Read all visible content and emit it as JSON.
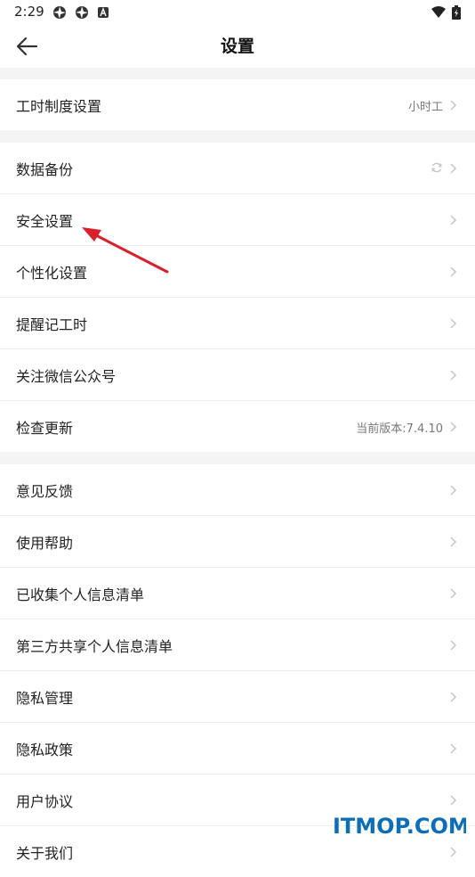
{
  "status_bar": {
    "time": "2:29",
    "left_icons": [
      "aperture-icon",
      "aperture-icon",
      "font-icon"
    ],
    "right_icons": [
      "wifi-icon",
      "battery-icon"
    ]
  },
  "header": {
    "title": "设置",
    "back_icon": "arrow-left-icon"
  },
  "groups": [
    {
      "items": [
        {
          "label": "工时制度设置",
          "value": "小时工"
        }
      ]
    },
    {
      "items": [
        {
          "label": "数据备份",
          "icon": "sync-icon"
        },
        {
          "label": "安全设置"
        },
        {
          "label": "个性化设置"
        },
        {
          "label": "提醒记工时"
        },
        {
          "label": "关注微信公众号"
        },
        {
          "label": "检查更新",
          "value": "当前版本:7.4.10"
        }
      ]
    },
    {
      "items": [
        {
          "label": "意见反馈"
        },
        {
          "label": "使用帮助"
        },
        {
          "label": "已收集个人信息清单"
        },
        {
          "label": "第三方共享个人信息清单"
        },
        {
          "label": "隐私管理"
        },
        {
          "label": "隐私政策"
        },
        {
          "label": "用户协议"
        },
        {
          "label": "关于我们"
        }
      ]
    }
  ],
  "annotation": {
    "color": "#d9202a"
  },
  "watermark": "ITMOP.COM",
  "colors": {
    "background": "#f4f4f5",
    "row_bg": "#ffffff",
    "divider": "#ececec",
    "secondary_text": "#777777",
    "watermark": "#0d6eb8"
  }
}
